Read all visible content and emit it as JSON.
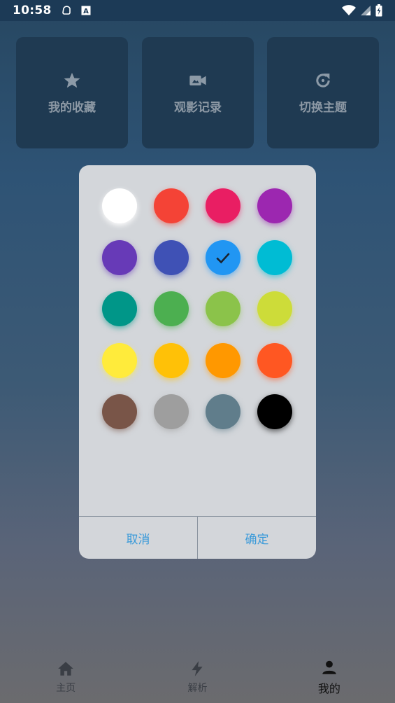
{
  "status_bar": {
    "time": "10:58",
    "icons": [
      "cast-icon",
      "app-a-icon",
      "wifi-icon",
      "signal-icon",
      "battery-charging-icon"
    ]
  },
  "quick_actions": [
    {
      "label": "我的收藏",
      "icon": "star-icon"
    },
    {
      "label": "观影记录",
      "icon": "video-camera-icon"
    },
    {
      "label": "切换主题",
      "icon": "refresh-icon"
    }
  ],
  "theme_dialog": {
    "colors": [
      "#ffffff",
      "#f44336",
      "#e91e63",
      "#9c27b0",
      "#673ab7",
      "#3f51b5",
      "#2196f3",
      "#00bcd4",
      "#009688",
      "#4caf50",
      "#8bc34a",
      "#cddc39",
      "#ffeb3b",
      "#ffc107",
      "#ff9800",
      "#ff5722",
      "#795548",
      "#9e9e9e",
      "#607d8b",
      "#000000"
    ],
    "selected_index": 6,
    "cancel_label": "取消",
    "confirm_label": "确定",
    "button_color": "#3a9ad9"
  },
  "bottom_nav": {
    "items": [
      {
        "label": "主页",
        "icon": "home-icon",
        "active": false
      },
      {
        "label": "解析",
        "icon": "lightning-icon",
        "active": false
      },
      {
        "label": "我的",
        "icon": "person-icon",
        "active": true
      }
    ]
  }
}
